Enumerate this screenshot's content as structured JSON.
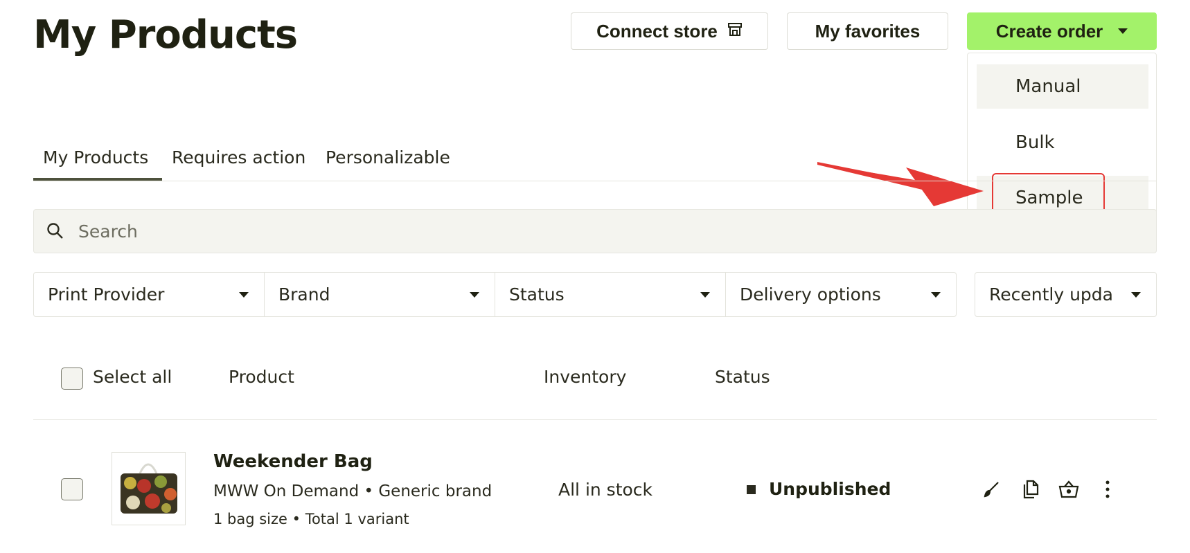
{
  "header": {
    "title": "My Products",
    "connect_store_label": "Connect store",
    "favorites_label": "My favorites",
    "create_order_label": "Create order"
  },
  "create_order_menu": {
    "items": [
      "Manual",
      "Bulk",
      "Sample"
    ],
    "highlighted": "Sample"
  },
  "tabs": [
    {
      "label": "My Products",
      "active": true
    },
    {
      "label": "Requires action",
      "active": false
    },
    {
      "label": "Personalizable",
      "active": false
    }
  ],
  "search": {
    "placeholder": "Search",
    "value": ""
  },
  "filters": [
    "Print Provider",
    "Brand",
    "Status",
    "Delivery options"
  ],
  "sort": {
    "label": "Recently upda"
  },
  "table": {
    "select_all_label": "Select all",
    "columns": [
      "Product",
      "Inventory",
      "Status"
    ],
    "rows": [
      {
        "name": "Weekender Bag",
        "subtitle": "MWW On Demand • Generic brand",
        "variants": "1 bag size • Total 1 variant",
        "inventory": "All in stock",
        "status": "Unpublished",
        "actions": [
          "brush-icon",
          "copy-icon",
          "basket-icon",
          "more-vertical-icon"
        ]
      }
    ]
  },
  "colors": {
    "accent": "#a3f26a",
    "annotation": "#e53935",
    "text": "#1f2112"
  }
}
